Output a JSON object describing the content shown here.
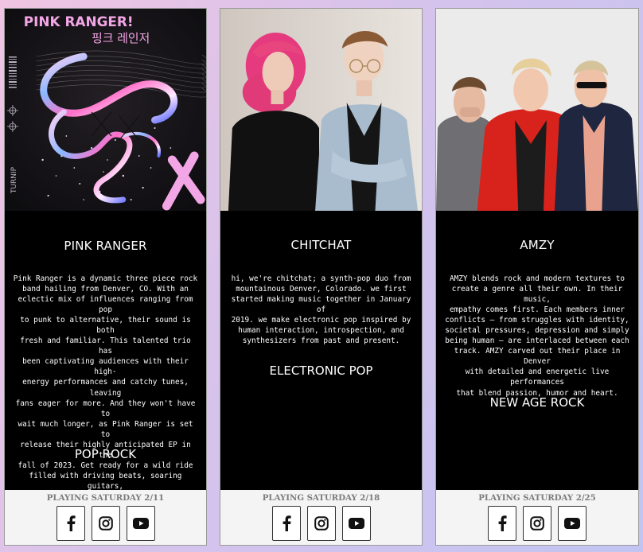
{
  "cards": [
    {
      "name": "PINK RANGER",
      "bio": "Pink Ranger is a dynamic three piece rock\nband hailing from Denver, CO. With an\neclectic mix of influences ranging from pop\nto punk to alternative, their sound is both\nfresh and familiar. This talented trio has\nbeen captivating audiences with their high-\nenergy performances and catchy tunes, leaving\nfans eager for more. And they won't have to\nwait much longer, as Pink Ranger is set to\nrelease their highly anticipated EP in the\nfall of 2023. Get ready for a wild ride\nfilled with driving beats, soaring guitars,\nand irresistible hooks, as Pink Ranger proves\nthat rock and roll is alive and well.",
      "genre": "POP ROCK",
      "playing": "PLAYING SATURDAY 2/11",
      "poster": {
        "title": "PINK RANGER!",
        "korean": "핑크 레인저",
        "side_text": "TURNIP"
      }
    },
    {
      "name": "CHITCHAT",
      "bio": "hi, we're chitchat; a synth-pop duo from\nmountainous Denver, Colorado. we first\nstarted making music together in January of\n2019. we make electronic pop inspired by\nhuman interaction, introspection, and\nsynthesizers from past and present.",
      "genre": "ELECTRONIC POP",
      "playing": "PLAYING SATURDAY 2/18"
    },
    {
      "name": "AMZY",
      "bio": "AMZY blends rock and modern textures to\ncreate a genre all their own. In their music,\nempathy comes first. Each members inner\nconflicts – from struggles with identity,\nsocietal pressures, depression and simply\nbeing human – are interlaced between each\ntrack. AMZY carved out their place in Denver\nwith detailed and energetic live performances\nthat blend passion, humor and heart.",
      "genre": "NEW AGE ROCK",
      "playing": "PLAYING SATURDAY 2/25"
    }
  ],
  "social_icons": [
    "facebook-icon",
    "instagram-icon",
    "youtube-icon"
  ],
  "colors": {
    "card_bg": "#000000",
    "footer_bg": "#f4f4f4",
    "playing_text": "#7b7b7b",
    "poster_pink": "#f3a6e6"
  }
}
